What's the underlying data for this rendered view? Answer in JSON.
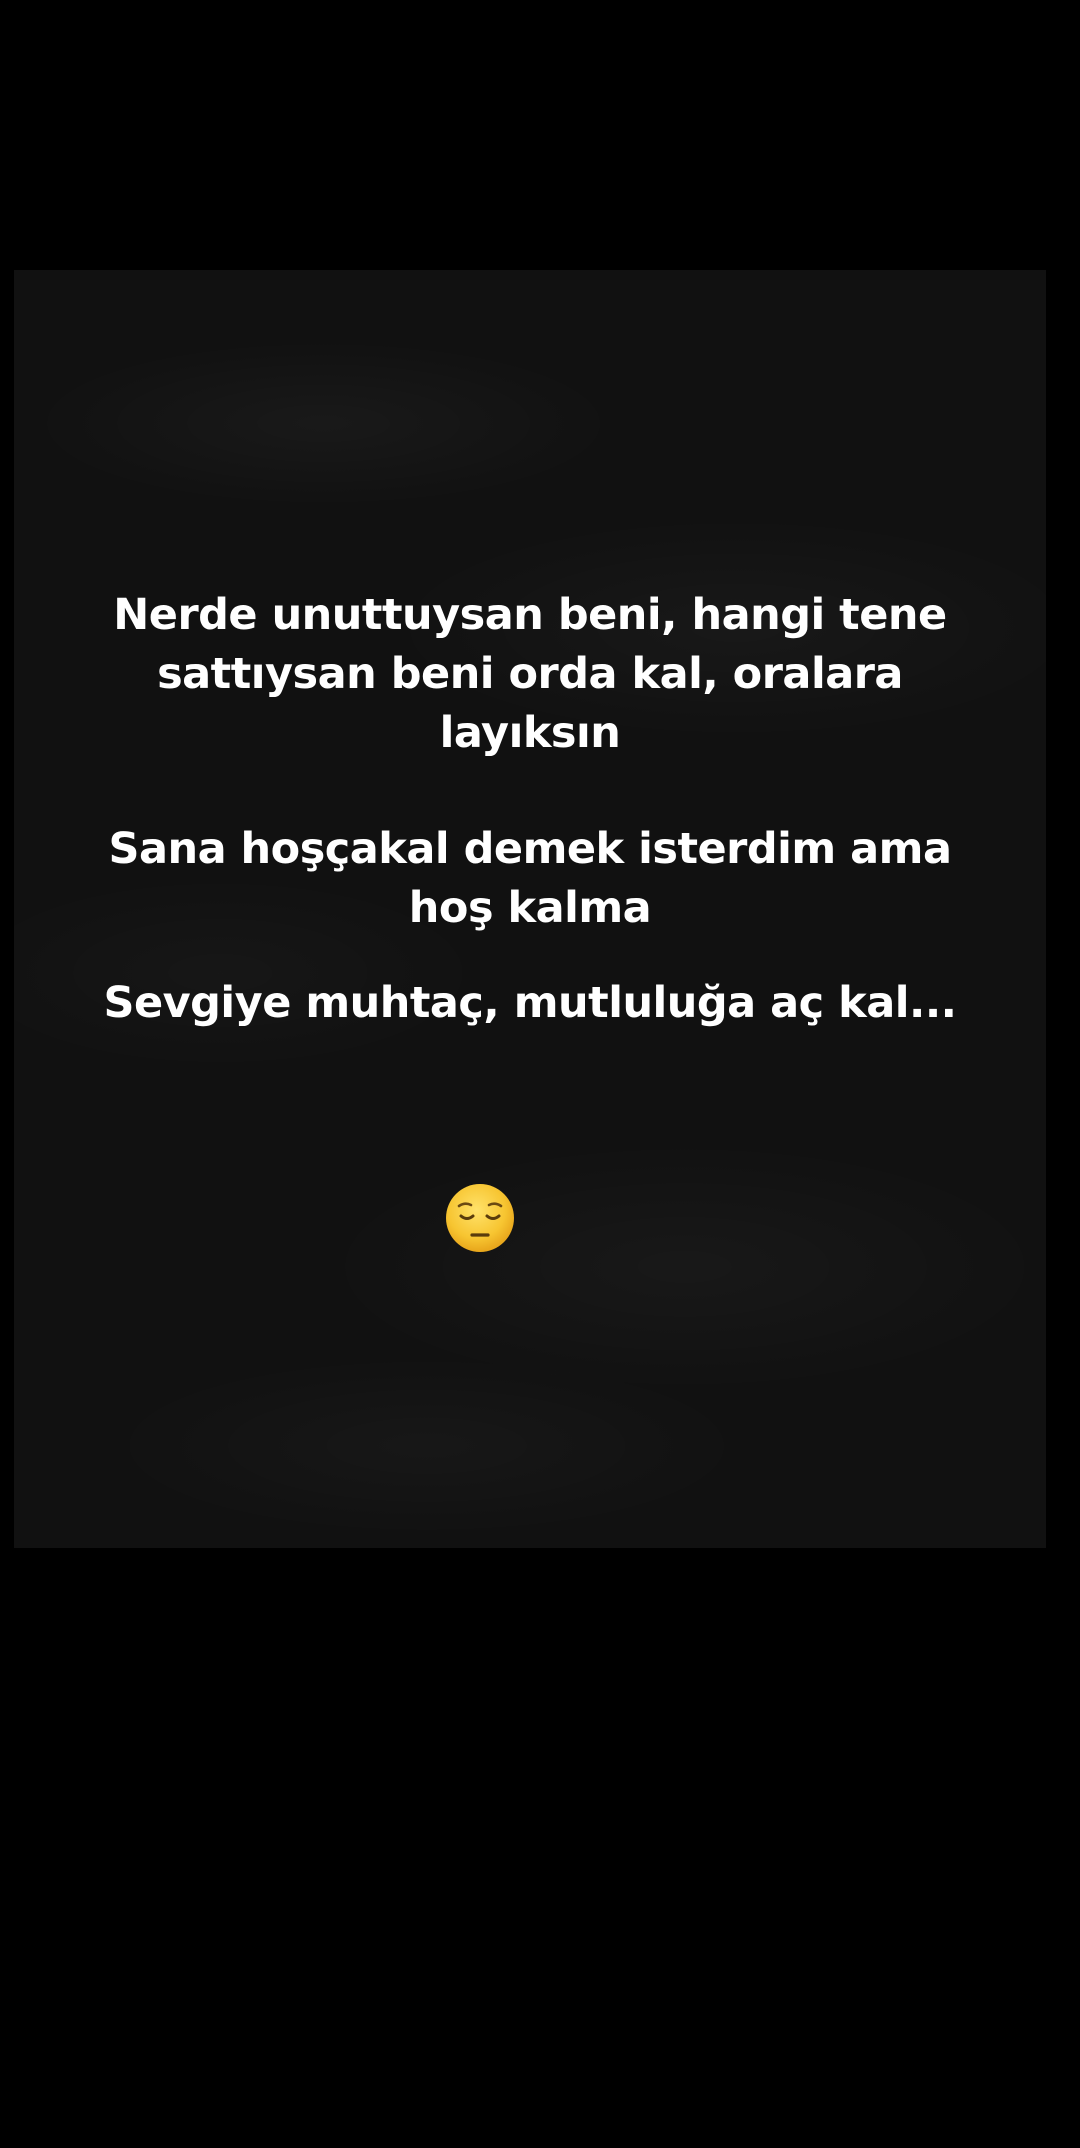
{
  "post": {
    "paragraphs": [
      {
        "lines": [
          "Nerde unuttuysan beni, hangi tene",
          "sattıysan beni orda kal, oralara",
          "layıksın"
        ]
      },
      {
        "lines": [
          "Sana hoşçakal demek isterdim ama",
          "hoş kalma"
        ]
      },
      {
        "lines": [
          "Sevgiye muhtaç, mutluluğa aç kal..."
        ]
      }
    ],
    "emoji": "pensive-face-icon"
  },
  "colors": {
    "page_background": "#000000",
    "card_background": "#111111",
    "text": "#ffffff",
    "emoji_face": "#f7c531"
  }
}
